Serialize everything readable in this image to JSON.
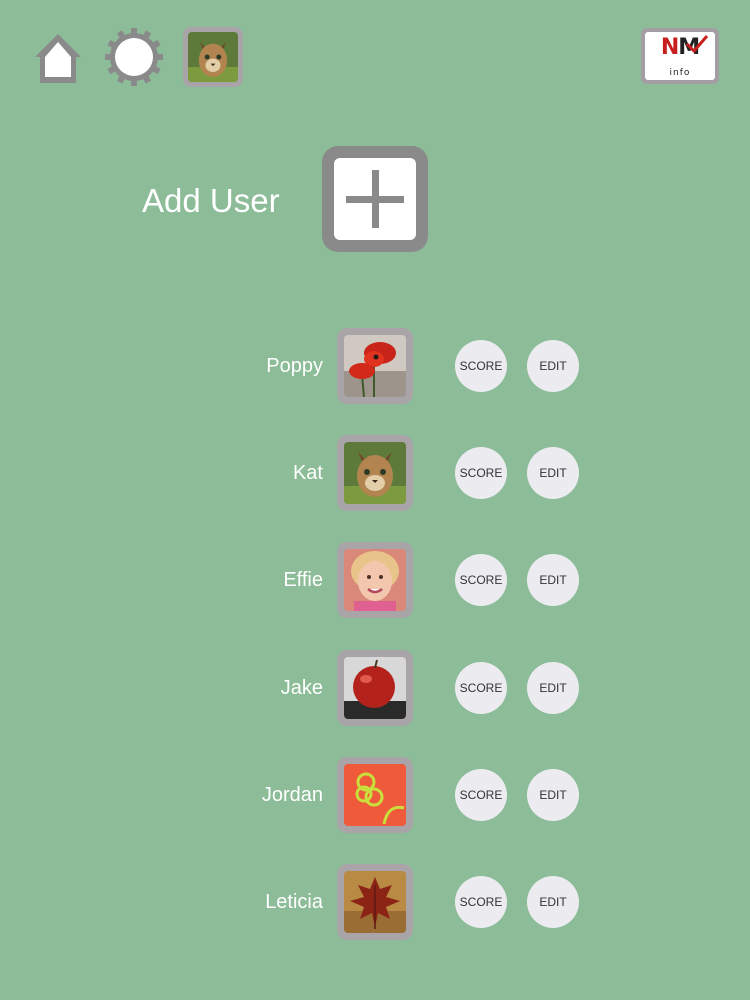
{
  "toolbar": {
    "home_icon": "home-icon",
    "settings_icon": "gear-icon",
    "current_user_avatar": "lynx-photo"
  },
  "logo": {
    "text_red": "N",
    "text_dark": "M",
    "subtext": "info"
  },
  "add_user": {
    "label": "Add User",
    "icon": "plus-icon"
  },
  "users": [
    {
      "name": "Poppy",
      "avatar": "poppy-photo",
      "score_label": "SCORE",
      "edit_label": "EDIT"
    },
    {
      "name": "Kat",
      "avatar": "lynx-photo",
      "score_label": "SCORE",
      "edit_label": "EDIT"
    },
    {
      "name": "Effie",
      "avatar": "child-photo",
      "score_label": "SCORE",
      "edit_label": "EDIT"
    },
    {
      "name": "Jake",
      "avatar": "apple-photo",
      "score_label": "SCORE",
      "edit_label": "EDIT"
    },
    {
      "name": "Jordan",
      "avatar": "rings-graphic",
      "score_label": "SCORE",
      "edit_label": "EDIT"
    },
    {
      "name": "Leticia",
      "avatar": "leaf-photo",
      "score_label": "SCORE",
      "edit_label": "EDIT"
    }
  ],
  "colors": {
    "background": "#8cbc98",
    "frame": "#a9a4a8",
    "button_bg": "#ececf0",
    "logo_red": "#c81e1e"
  }
}
